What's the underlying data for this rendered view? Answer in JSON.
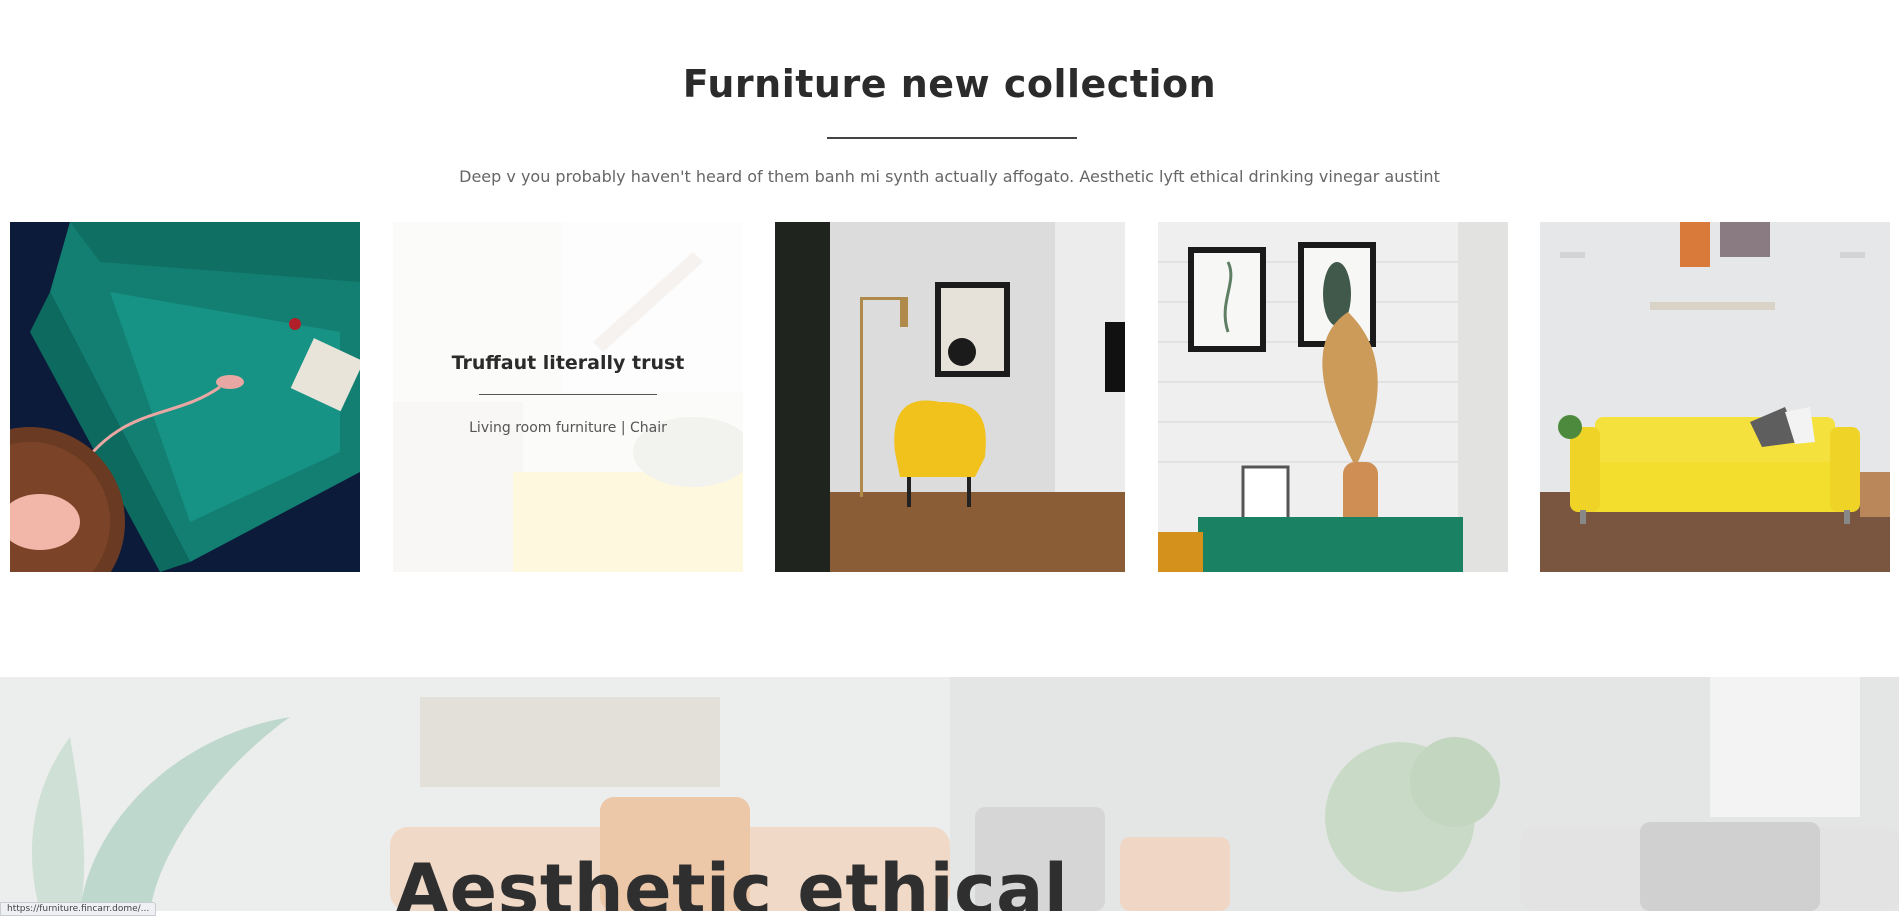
{
  "section": {
    "title": "Furniture new collection",
    "subtitle": "Deep v you probably haven't heard of them banh mi synth actually affogato. Aesthetic lyft ethical drinking vinegar austint"
  },
  "cards": [
    {
      "image": "green-velvet-sofa-with-pink-phone"
    },
    {
      "image": "white-living-room-with-yellow-sofa",
      "title": "Truffaut literally trust",
      "subtitle": "Living room furniture | Chair"
    },
    {
      "image": "yellow-armchair-with-floor-lamp"
    },
    {
      "image": "green-cabinet-with-dried-plants-vase"
    },
    {
      "image": "yellow-sofa-with-shelf"
    }
  ],
  "banner": {
    "title": "Aesthetic ethical",
    "image": "bright-living-room-background"
  },
  "status_bar": {
    "link_text": "https://furniture.fincarr.dome/..."
  },
  "colors": {
    "heading": "#2b2b2b",
    "body_text": "#666666",
    "teal": "#127f72",
    "yellow": "#f2c63a",
    "navy": "#0d1b3b"
  }
}
